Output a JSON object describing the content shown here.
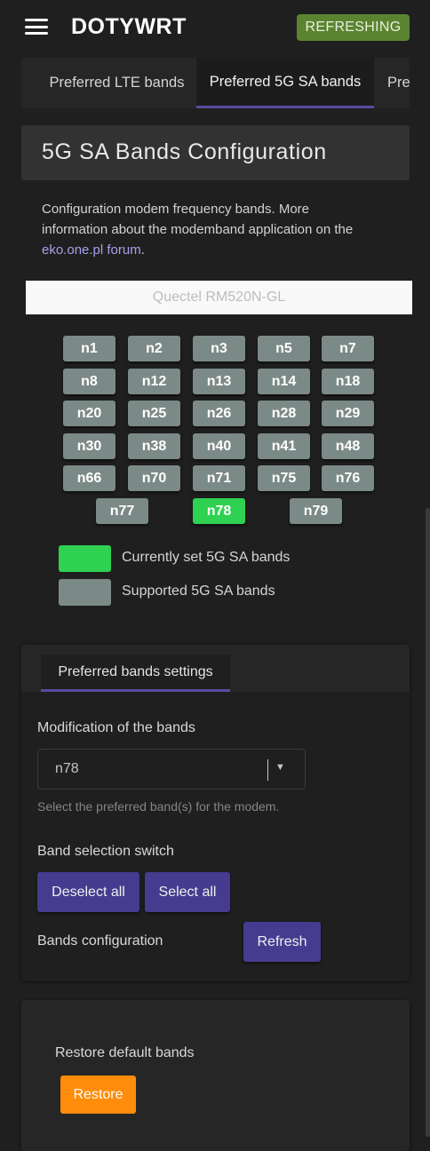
{
  "header": {
    "menu_icon": "hamburger-menu-icon",
    "brand": "DOTYWRT",
    "status_badge": "REFRESHING",
    "status_color": "#5b8431"
  },
  "tabs": [
    {
      "label": "Preferred LTE bands",
      "active": false
    },
    {
      "label": "Preferred 5G SA bands",
      "active": true
    },
    {
      "label": "Pre",
      "active": false
    }
  ],
  "section": {
    "title": "5G SA Bands Configuration",
    "description_line1": "Configuration modem frequency bands. More",
    "description_line2": "information about the modemband application on the",
    "description_link": "eko.one.pl forum",
    "description_end": "."
  },
  "modem": {
    "name": "Quectel RM520N-GL"
  },
  "bands": [
    {
      "name": "n1",
      "active": false
    },
    {
      "name": "n2",
      "active": false
    },
    {
      "name": "n3",
      "active": false
    },
    {
      "name": "n5",
      "active": false
    },
    {
      "name": "n7",
      "active": false
    },
    {
      "name": "n8",
      "active": false
    },
    {
      "name": "n12",
      "active": false
    },
    {
      "name": "n13",
      "active": false
    },
    {
      "name": "n14",
      "active": false
    },
    {
      "name": "n18",
      "active": false
    },
    {
      "name": "n20",
      "active": false
    },
    {
      "name": "n25",
      "active": false
    },
    {
      "name": "n26",
      "active": false
    },
    {
      "name": "n28",
      "active": false
    },
    {
      "name": "n29",
      "active": false
    },
    {
      "name": "n30",
      "active": false
    },
    {
      "name": "n38",
      "active": false
    },
    {
      "name": "n40",
      "active": false
    },
    {
      "name": "n41",
      "active": false
    },
    {
      "name": "n48",
      "active": false
    },
    {
      "name": "n66",
      "active": false
    },
    {
      "name": "n70",
      "active": false
    },
    {
      "name": "n71",
      "active": false
    },
    {
      "name": "n75",
      "active": false
    },
    {
      "name": "n76",
      "active": false
    },
    {
      "name": "n77",
      "active": false
    },
    {
      "name": "n78",
      "active": true
    },
    {
      "name": "n79",
      "active": false
    }
  ],
  "legend": {
    "current_label": "Currently set 5G SA bands",
    "current_color": "#2ed152",
    "supported_label": "Supported 5G SA bands",
    "supported_color": "#7c8a87"
  },
  "settings": {
    "tab_label": "Preferred bands settings",
    "modification_label": "Modification of the bands",
    "selected_value": "n78",
    "caret_icon": "caret-down-icon",
    "hint": "Select the preferred band(s) for the modem.",
    "switch_label": "Band selection switch",
    "deselect_label": "Deselect all",
    "select_label": "Select all",
    "config_label": "Bands configuration",
    "refresh_label": "Refresh",
    "button_color": "#453b8f"
  },
  "restore": {
    "label": "Restore default bands",
    "button": "Restore",
    "button_color": "#ff8c0a"
  }
}
